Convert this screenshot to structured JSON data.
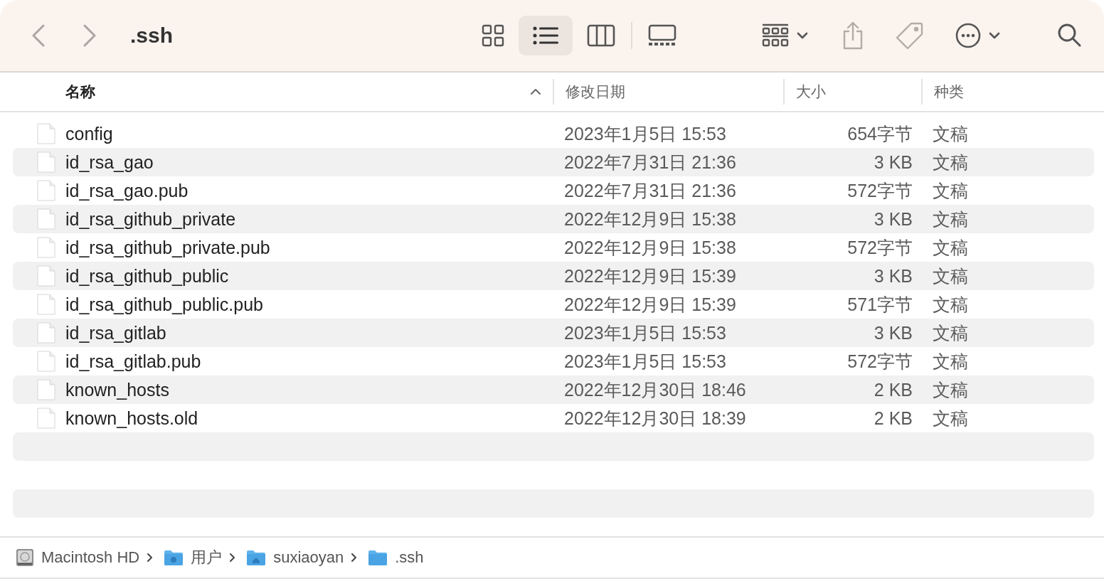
{
  "toolbar": {
    "title": ".ssh",
    "view_modes": [
      {
        "kind": "icons",
        "selected": false
      },
      {
        "kind": "list",
        "selected": true
      },
      {
        "kind": "columns",
        "selected": false
      },
      {
        "kind": "gallery",
        "selected": false
      }
    ]
  },
  "columns": [
    {
      "label": "名称",
      "sorted": true
    },
    {
      "label": "修改日期",
      "sorted": false
    },
    {
      "label": "大小",
      "sorted": false
    },
    {
      "label": "种类",
      "sorted": false
    }
  ],
  "rows": [
    {
      "name": "config",
      "date": "2023年1月5日 15:53",
      "size": "654字节",
      "kind": "文稿"
    },
    {
      "name": "id_rsa_gao",
      "date": "2022年7月31日 21:36",
      "size": "3 KB",
      "kind": "文稿"
    },
    {
      "name": "id_rsa_gao.pub",
      "date": "2022年7月31日 21:36",
      "size": "572字节",
      "kind": "文稿"
    },
    {
      "name": "id_rsa_github_private",
      "date": "2022年12月9日 15:38",
      "size": "3 KB",
      "kind": "文稿"
    },
    {
      "name": "id_rsa_github_private.pub",
      "date": "2022年12月9日 15:38",
      "size": "572字节",
      "kind": "文稿"
    },
    {
      "name": "id_rsa_github_public",
      "date": "2022年12月9日 15:39",
      "size": "3 KB",
      "kind": "文稿"
    },
    {
      "name": "id_rsa_github_public.pub",
      "date": "2022年12月9日 15:39",
      "size": "571字节",
      "kind": "文稿"
    },
    {
      "name": "id_rsa_gitlab",
      "date": "2023年1月5日 15:53",
      "size": "3 KB",
      "kind": "文稿"
    },
    {
      "name": "id_rsa_gitlab.pub",
      "date": "2023年1月5日 15:53",
      "size": "572字节",
      "kind": "文稿"
    },
    {
      "name": "known_hosts",
      "date": "2022年12月30日 18:46",
      "size": "2 KB",
      "kind": "文稿"
    },
    {
      "name": "known_hosts.old",
      "date": "2022年12月30日 18:39",
      "size": "2 KB",
      "kind": "文稿"
    }
  ],
  "path": [
    {
      "label": "Macintosh HD",
      "kind": "disk"
    },
    {
      "label": "用户",
      "kind": "users"
    },
    {
      "label": "suxiaoyan",
      "kind": "home"
    },
    {
      "label": ".ssh",
      "kind": "folder"
    }
  ]
}
